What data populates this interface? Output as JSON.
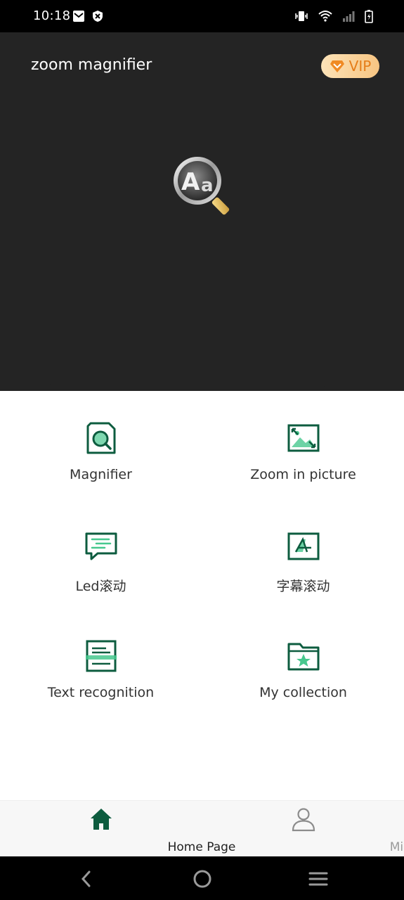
{
  "status_bar": {
    "time": "10:18",
    "left_icons": [
      "mail-icon",
      "shield-icon"
    ],
    "right_icons": [
      "vibrate-icon",
      "wifi-icon",
      "signal-icon",
      "battery-charging-icon"
    ]
  },
  "header": {
    "title": "zoom magnifier",
    "vip_label": "VIP",
    "logo_icon": "aa-magnifier-logo-icon"
  },
  "features": [
    {
      "label": "Magnifier",
      "icon": "magnifier-document-icon"
    },
    {
      "label": "Zoom in picture",
      "icon": "zoom-picture-icon"
    },
    {
      "label": "Led滚动",
      "icon": "led-chat-icon"
    },
    {
      "label": "字幕滚动",
      "icon": "subtitle-icon"
    },
    {
      "label": "Text recognition",
      "icon": "text-recognition-icon"
    },
    {
      "label": "My collection",
      "icon": "collection-folder-icon"
    }
  ],
  "bottom_nav": {
    "items": [
      {
        "label": "Home Page",
        "icon": "home-icon",
        "active": true
      },
      {
        "label": "Mine",
        "icon": "person-icon",
        "active": false
      }
    ]
  },
  "system_nav": [
    "back-icon",
    "home-circle-icon",
    "menu-icon"
  ],
  "colors": {
    "hero_bg": "#242424",
    "accent_green": "#0d5c3f",
    "light_green": "#47c88e",
    "vip_text": "#e57d19"
  }
}
